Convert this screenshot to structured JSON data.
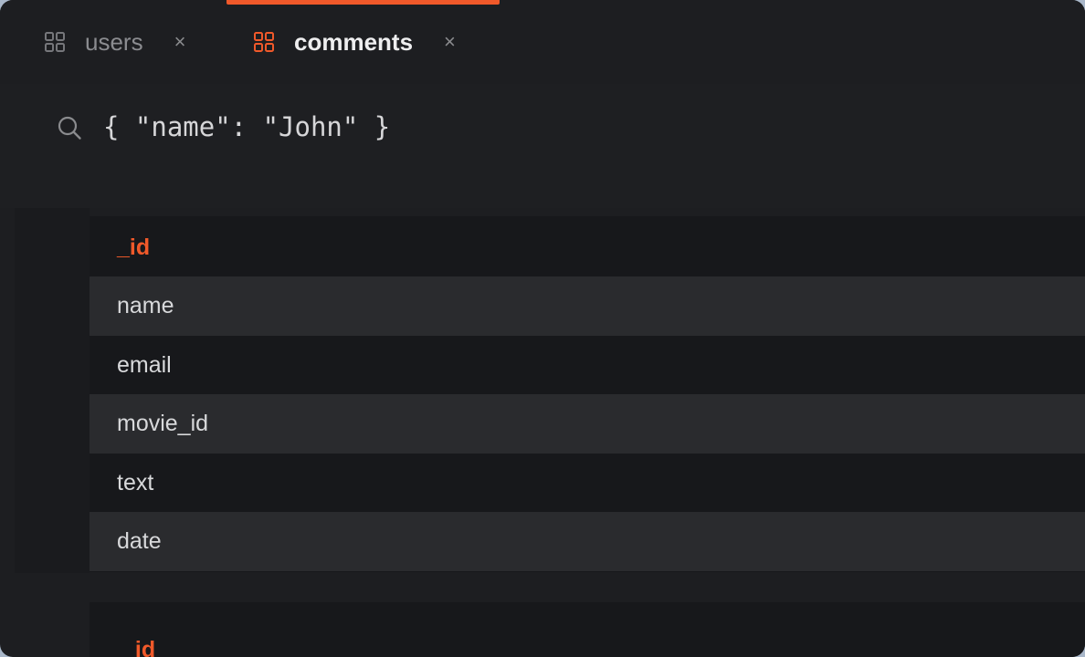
{
  "tabs": [
    {
      "label": "users",
      "active": false,
      "icon": "grid-icon",
      "close_glyph": "×"
    },
    {
      "label": "comments",
      "active": true,
      "icon": "grid-icon",
      "close_glyph": "×"
    }
  ],
  "query": {
    "icon": "search-icon",
    "text": "{ \"name\": \"John\" }"
  },
  "documents": [
    {
      "fields": [
        "_id",
        "name",
        "email",
        "movie_id",
        "text",
        "date"
      ]
    },
    {
      "fields": [
        "_id"
      ]
    }
  ],
  "colors": {
    "accent": "#f0592a",
    "background": "#1d1e21",
    "row_alt": "#2a2b2e",
    "row": "#17181b"
  }
}
